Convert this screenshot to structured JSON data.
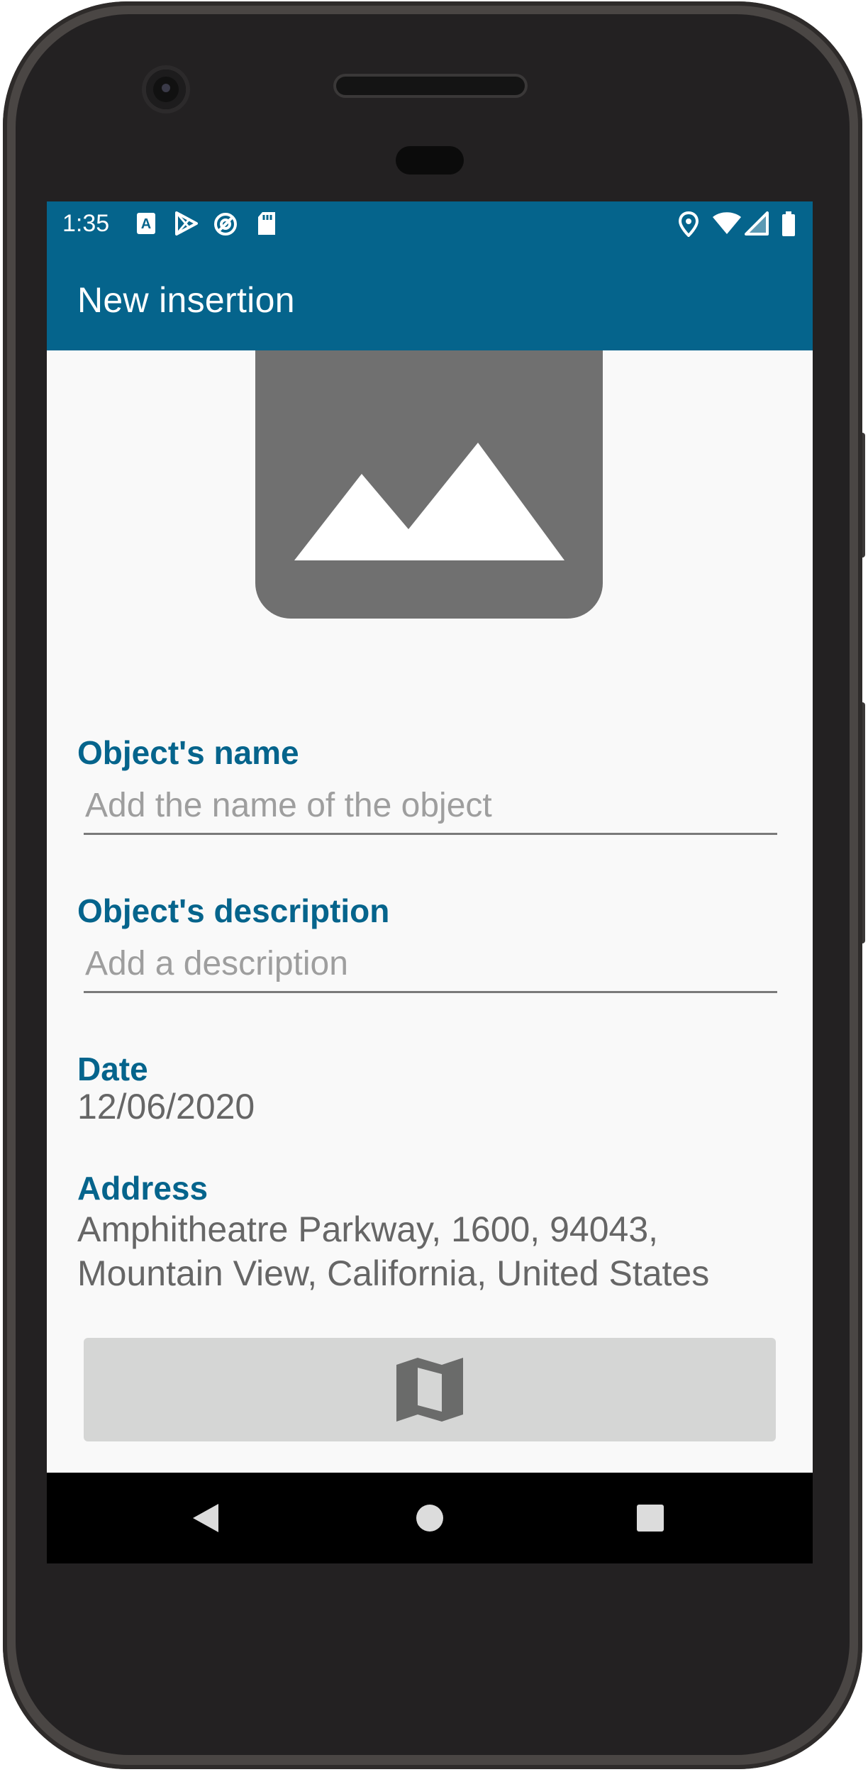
{
  "status_bar": {
    "time": "1:35",
    "left_icons": [
      "font-a-icon",
      "play-store-icon",
      "do-not-disturb-icon",
      "sd-card-icon"
    ],
    "right_icons": [
      "location-pin-icon",
      "wifi-icon",
      "cell-signal-icon",
      "battery-icon"
    ]
  },
  "app_bar": {
    "title": "New insertion"
  },
  "image_placeholder": {
    "icon": "image-placeholder-icon"
  },
  "form": {
    "name": {
      "label": "Object's name",
      "placeholder": "Add the name of the object",
      "value": ""
    },
    "description": {
      "label": "Object's description",
      "placeholder": "Add a description",
      "value": ""
    },
    "date": {
      "label": "Date",
      "value": "12/06/2020"
    },
    "address": {
      "label": "Address",
      "line1": "Amphitheatre Parkway, 1600, 94043,",
      "line2": "Mountain View, California, United States"
    },
    "map_button": {
      "icon": "map-icon"
    }
  },
  "nav_bar": {
    "items": [
      "back-icon",
      "home-icon",
      "recents-icon"
    ]
  },
  "colors": {
    "primary": "#05648c",
    "background": "#f9f9f9",
    "placeholder_gray": "#707070",
    "button_gray": "#d5d6d5"
  }
}
